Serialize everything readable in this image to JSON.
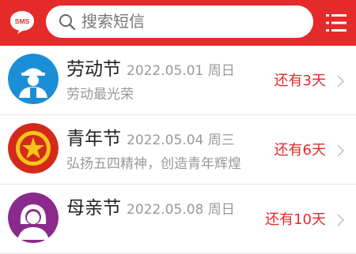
{
  "header": {
    "logo_text": "SMS",
    "search_placeholder": "搜索短信",
    "brand_color": "#e52a2a"
  },
  "icons": {
    "logo": "sms-bubble-icon",
    "search": "search-icon",
    "menu": "menu-list-icon",
    "chevron": "chevron-right-icon"
  },
  "holidays": [
    {
      "title": "劳动节",
      "date": "2022.05.01 周日",
      "subtitle": "劳动最光荣",
      "countdown": "还有3天",
      "avatar_icon": "worker-avatar-icon",
      "avatar_color": "#1a8fd8"
    },
    {
      "title": "青年节",
      "date": "2022.05.04 周三",
      "subtitle": "弘扬五四精神，创造青年辉煌",
      "countdown": "还有6天",
      "avatar_icon": "star-badge-icon",
      "avatar_color": "#d42a1c"
    },
    {
      "title": "母亲节",
      "date": "2022.05.08 周日",
      "subtitle": "",
      "countdown": "还有10天",
      "avatar_icon": "mother-avatar-icon",
      "avatar_color": "#8a2a8c"
    }
  ]
}
